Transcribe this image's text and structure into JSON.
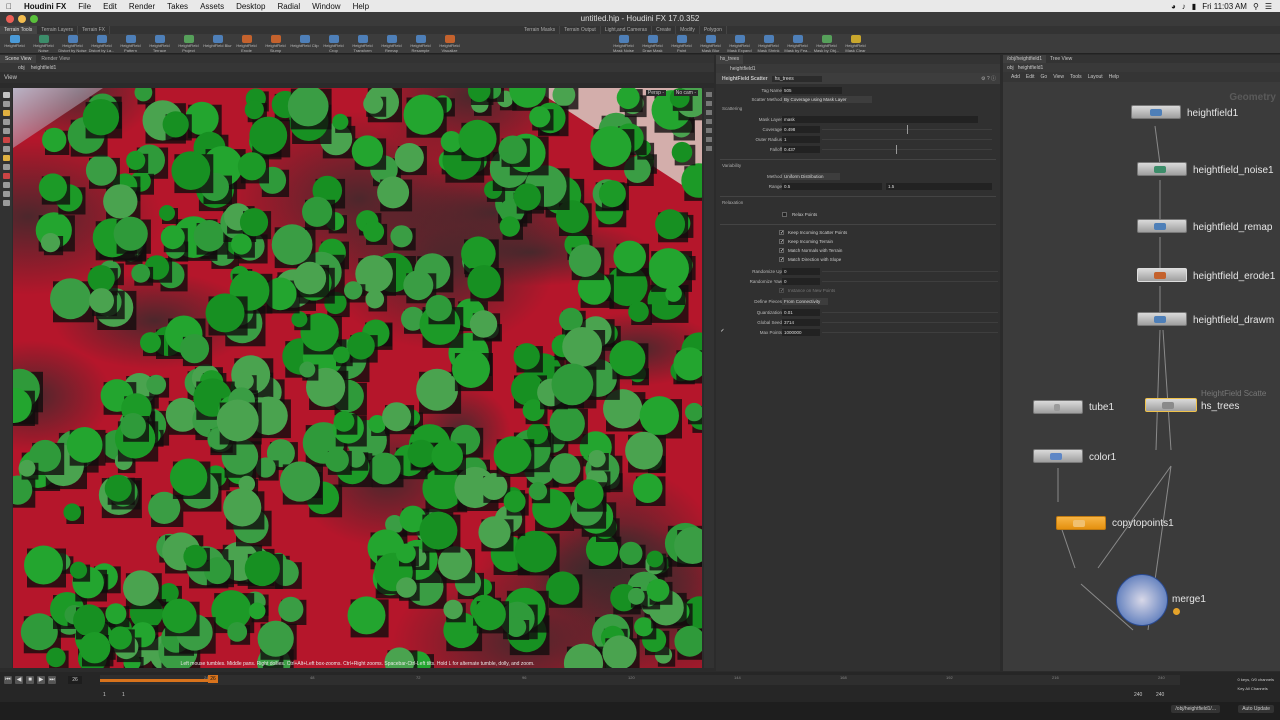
{
  "menubar": {
    "app": "Houdini FX",
    "items": [
      "File",
      "Edit",
      "Render",
      "Takes",
      "Assets",
      "Desktop",
      "Radial",
      "Window",
      "Help"
    ],
    "clock": "Fri 11:03 AM"
  },
  "window": {
    "title": "untitled.hip - Houdini FX 17.0.352"
  },
  "shelf": {
    "tabs": [
      "Terrain Tools",
      "Terrain Layers",
      "Terrain FX",
      "Terrain Masks",
      "Terrain Output",
      "Light,and Cameras",
      "Create",
      "Modify",
      "Polygon"
    ],
    "tools": [
      {
        "label": "HeightField",
        "color": "#4a9ad8"
      },
      {
        "label": "HeightField Noise",
        "color": "#3c8d6a"
      },
      {
        "label": "HeightField Distort by Noise",
        "color": "#4e7fb8"
      },
      {
        "label": "HeightField Distort by La...",
        "color": "#4e7fb8"
      },
      {
        "label": "HeightField Pattern",
        "color": "#4e7fb8"
      },
      {
        "label": "HeightField Terrace",
        "color": "#4e7fb8"
      },
      {
        "label": "HeightField Project",
        "color": "#56a05a"
      },
      {
        "label": "HeightField Blur",
        "color": "#4e7fb8"
      },
      {
        "label": "HeightField Erode",
        "color": "#c4622d"
      },
      {
        "label": "HeightField Slump",
        "color": "#c4622d"
      },
      {
        "label": "HeightField Clip",
        "color": "#4e7fb8"
      },
      {
        "label": "HeightField Crop",
        "color": "#4e7fb8"
      },
      {
        "label": "HeightField Transform",
        "color": "#4e7fb8"
      },
      {
        "label": "HeightField Remap",
        "color": "#4e7fb8"
      },
      {
        "label": "HeightField Resample",
        "color": "#4e7fb8"
      },
      {
        "label": "HeightField Visualize",
        "color": "#c4622d"
      },
      {
        "label": "",
        "color": "#3c3c3c"
      },
      {
        "label": "",
        "color": "#3c3c3c"
      },
      {
        "label": "",
        "color": "#3c3c3c"
      },
      {
        "label": "",
        "color": "#3c3c3c"
      },
      {
        "label": "",
        "color": "#3c3c3c"
      },
      {
        "label": "HeightField Mask Noise",
        "color": "#4e7fb8"
      },
      {
        "label": "HeightField Draw Mask",
        "color": "#4e7fb8"
      },
      {
        "label": "HeightField Paint",
        "color": "#4e7fb8"
      },
      {
        "label": "HeightField Mask Blur",
        "color": "#4e7fb8"
      },
      {
        "label": "HeightField Mask Expand",
        "color": "#4e7fb8"
      },
      {
        "label": "HeightField Mask Shrink",
        "color": "#4e7fb8"
      },
      {
        "label": "HeightField Mask by Fea...",
        "color": "#4e7fb8"
      },
      {
        "label": "HeightField Mask by Obj...",
        "color": "#56a05a"
      },
      {
        "label": "HeightField Mask Clear",
        "color": "#c9a72d"
      }
    ]
  },
  "left_pane": {
    "tabs": [
      "Scene View",
      "Render View"
    ],
    "path": [
      "obj",
      "heightfield1"
    ],
    "view_label": "View",
    "persp": "Persp -",
    "nocam": "No cam -",
    "status_hint": "Left mouse tumbles. Middle pans. Right dollies. Ctrl+Alt+Left box-zooms. Ctrl+Right zooms. Spacebar-Ctrl-Left tilts. Hold L for alternate tumble, dolly, and zoom."
  },
  "timeline": {
    "frame": "26",
    "start": "1",
    "start2": "1",
    "end": "240",
    "end2": "240",
    "ticks": [
      "24",
      "48",
      "72",
      "96",
      "120",
      "144",
      "168",
      "192",
      "216",
      "240"
    ],
    "current": "26",
    "keys_info": "0 keys, 0/0 channels",
    "key_all": "Key All Channels"
  },
  "status": {
    "path": "/obj/heightfield1/...",
    "auto_update": "Auto Update"
  },
  "params": {
    "tabs": [
      "hs_trees"
    ],
    "path": "heightfield1",
    "node_type": "HeightField Scatter",
    "node_name": "hs_trees",
    "tag_name_label": "Tag Name",
    "tag_name": "505",
    "scatter_method_label": "Scatter Method",
    "scatter_method": "By Coverage using Mask Layer",
    "scattering_section": "Scattering",
    "mask_layer_label": "Mask Layer",
    "mask_layer": "mask",
    "coverage_label": "Coverage",
    "coverage": "0.498",
    "coverage_frac": 0.498,
    "outer_radius_label": "Outer Radius",
    "outer_radius": "1",
    "falloff_label": "Falloff",
    "falloff": "0.437",
    "falloff_frac": 0.437,
    "variability_section": "Variability",
    "method_label": "Method",
    "method": "Uniform Distribution",
    "range_label": "Range",
    "range_min": "0.5",
    "range_max": "1.5",
    "relaxation_section": "Relaxation",
    "relax_points": "Relax Points",
    "keep_scatter": "Keep Incoming Scatter Points",
    "keep_terrain": "Keep Incoming Terrain",
    "match_normals": "Match Normals with Terrain",
    "match_direction": "Match Direction with Slope",
    "randomize_up_label": "Randomize Up",
    "randomize_up": "0",
    "randomize_yaw_label": "Randomize Yaw",
    "randomize_yaw": "0",
    "instance_label": "Instance on New Points",
    "define_pieces_label": "Define Pieces",
    "define_pieces": "From Connectivity",
    "quantization_label": "Quantization",
    "quantization": "0.01",
    "global_seed_label": "Global Seed",
    "global_seed": "3714",
    "max_points_label": "Max Points",
    "max_points": "1000000"
  },
  "network": {
    "tabs": [
      "/obj/heightfield1",
      "Tree View"
    ],
    "path": [
      "obj",
      "heightfield1"
    ],
    "menu": [
      "Add",
      "Edit",
      "Go",
      "View",
      "Tools",
      "Layout",
      "Help"
    ],
    "context": "Geometry",
    "nodes": {
      "heightfield1": "heightfield1",
      "noise": "heightfield_noise1",
      "remap": "heightfield_remap",
      "erode": "heightfield_erode1",
      "drawmask": "heightfield_drawm",
      "hs_trees": "hs_trees",
      "hs_trees_type": "HeightField Scatte",
      "tube": "tube1",
      "color": "color1",
      "copy": "copytopoints1",
      "merge": "merge1"
    }
  },
  "colors": {
    "terrain_red": "#b5162b",
    "tree_green": "#1f9a2a",
    "selected_node": "#f0a21c"
  }
}
